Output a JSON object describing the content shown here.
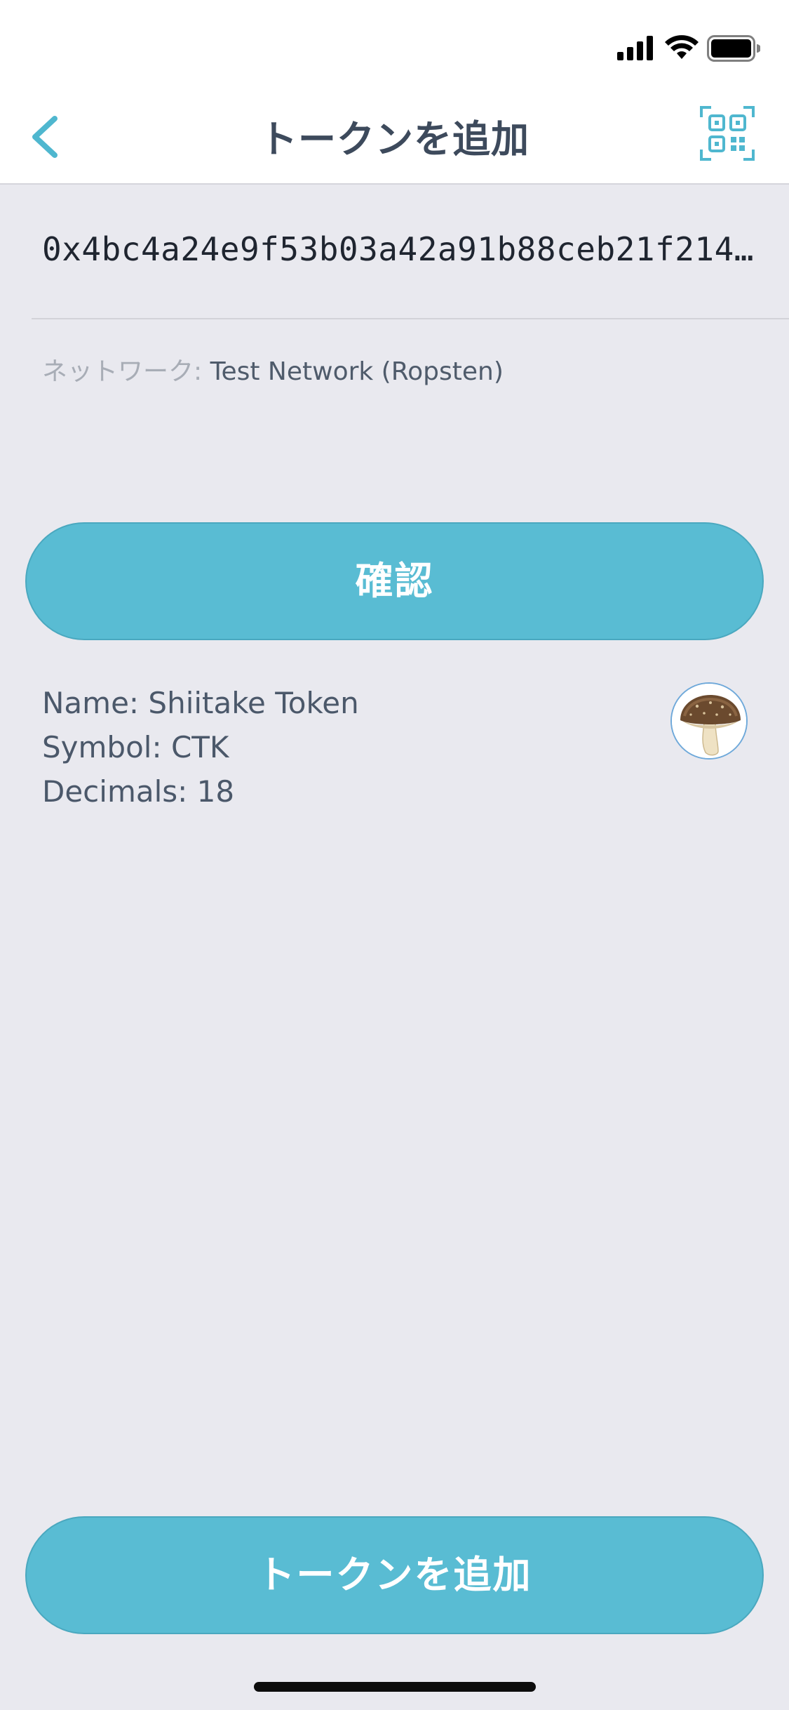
{
  "nav": {
    "title": "トークンを追加"
  },
  "form": {
    "address_value": "0x4bc4a24e9f53b03a42a91b88ceb21f214…",
    "network_label": "ネットワーク:",
    "network_value": "Test Network (Ropsten)"
  },
  "confirm_button": {
    "label": "確認"
  },
  "token": {
    "name_line": "Name: Shiitake Token",
    "symbol_line": "Symbol: CTK",
    "decimals_line": "Decimals: 18",
    "avatar_icon": "mushroom-icon"
  },
  "add_button": {
    "label": "トークンを追加"
  },
  "colors": {
    "accent": "#59bcd3",
    "background": "#e9e9ef",
    "text": "#3d4a5c"
  }
}
